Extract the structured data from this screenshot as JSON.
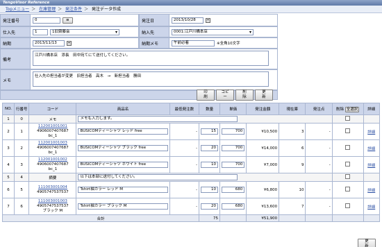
{
  "app": {
    "title": "TengoVisor Reference"
  },
  "breadcrumb": [
    "Topメニュー",
    "在庫管理",
    "発注条件",
    "発注データ作成"
  ],
  "form": {
    "order_no_label": "発注番号",
    "order_no_value": "0",
    "order_no_btn": "≡",
    "order_date_label": "発注日",
    "order_date_value": "2013/10/28",
    "supplier_label": "仕入先",
    "supplier_code": "1",
    "supplier_name": "1旧齋藤会",
    "delivery_label": "納入先",
    "delivery_value": "0001:江戸川橋本店",
    "due_label": "納期",
    "due_value": "2013/11/13",
    "due_memo_label": "納期メモ",
    "due_memo_value": "午前必着",
    "due_memo_hint": "※全角10文字",
    "remarks_label": "備考",
    "remarks_value": "江戸川橋本店　添長　田中宛てにて送付してください。",
    "memo_label": "メモ",
    "memo_value": "仕入先の担当者が変更　旧担当者　高木　→　新担当者　勝田"
  },
  "actions": {
    "print": "印　刷",
    "copy": "コピー",
    "delete": "削　除",
    "update": "更　新"
  },
  "table": {
    "headers": [
      "NO.",
      "行番号",
      "コード",
      "商品名",
      "最低発注数",
      "数量",
      "単価",
      "発注金額",
      "現在庫",
      "発注点",
      "削除",
      "全選択",
      "詳細"
    ],
    "rows": [
      {
        "no": "1",
        "line": "0",
        "code_link": "",
        "code_jan": "",
        "code_sub": "",
        "code_text": "メモ",
        "name": "メモも入力します。",
        "min": "",
        "qty": "",
        "price": "",
        "amount": "",
        "stock": "",
        "point": "",
        "detail": "",
        "memo": true
      },
      {
        "no": "2",
        "line": "1",
        "code_link": "112001001001",
        "code_jan": "4906007407687",
        "code_sub": "bc_1",
        "code_text": "",
        "name": "BUSICOMティーシャツ レッド free",
        "min": "-",
        "qty": "15",
        "price": "700",
        "amount": "¥10,500",
        "stock": "3",
        "point": "-",
        "detail": "詳細"
      },
      {
        "no": "3",
        "line": "2",
        "code_link": "112001001003",
        "code_jan": "4906007407687",
        "code_sub": "bc_1",
        "code_text": "",
        "name": "BUSICOMティーシャツ ブラック free",
        "min": "-",
        "qty": "20",
        "price": "700",
        "amount": "¥14,000",
        "stock": "6",
        "point": "-",
        "detail": "詳細"
      },
      {
        "no": "4",
        "line": "3",
        "code_link": "112001001002",
        "code_jan": "4906007407687",
        "code_sub": "bc_1",
        "code_text": "",
        "name": "BUSICOMティーシャツ ホワイト free",
        "min": "-",
        "qty": "10",
        "price": "700",
        "amount": "¥7,000",
        "stock": "9",
        "point": "-",
        "detail": "詳細"
      },
      {
        "no": "5",
        "line": "4",
        "code_link": "",
        "code_jan": "",
        "code_sub": "",
        "code_text": "摘要",
        "name": "以下は本部に送付してください。",
        "min": "",
        "qty": "",
        "price": "",
        "amount": "",
        "stock": "",
        "point": "",
        "detail": "",
        "memo": true
      },
      {
        "no": "6",
        "line": "5",
        "code_link": "111003001004",
        "code_jan": "4905747537537",
        "code_sub": "",
        "code_text": "",
        "name": "Tshirt袖カラー レッド M",
        "min": "-",
        "qty": "10",
        "price": "680",
        "amount": "¥6,800",
        "stock": "10",
        "point": "-",
        "detail": "詳細"
      },
      {
        "no": "7",
        "line": "6",
        "code_link": "111003001003",
        "code_jan": "4905747537537",
        "code_sub": "ブラック M",
        "code_text": "",
        "name": "Tshirt袖カラー ブラック M",
        "min": "-",
        "qty": "20",
        "price": "680",
        "amount": "¥13,600",
        "stock": "7",
        "point": "-",
        "detail": "詳細"
      }
    ],
    "total_label": "合計",
    "total_qty": "75",
    "total_amount": "¥51,900"
  }
}
